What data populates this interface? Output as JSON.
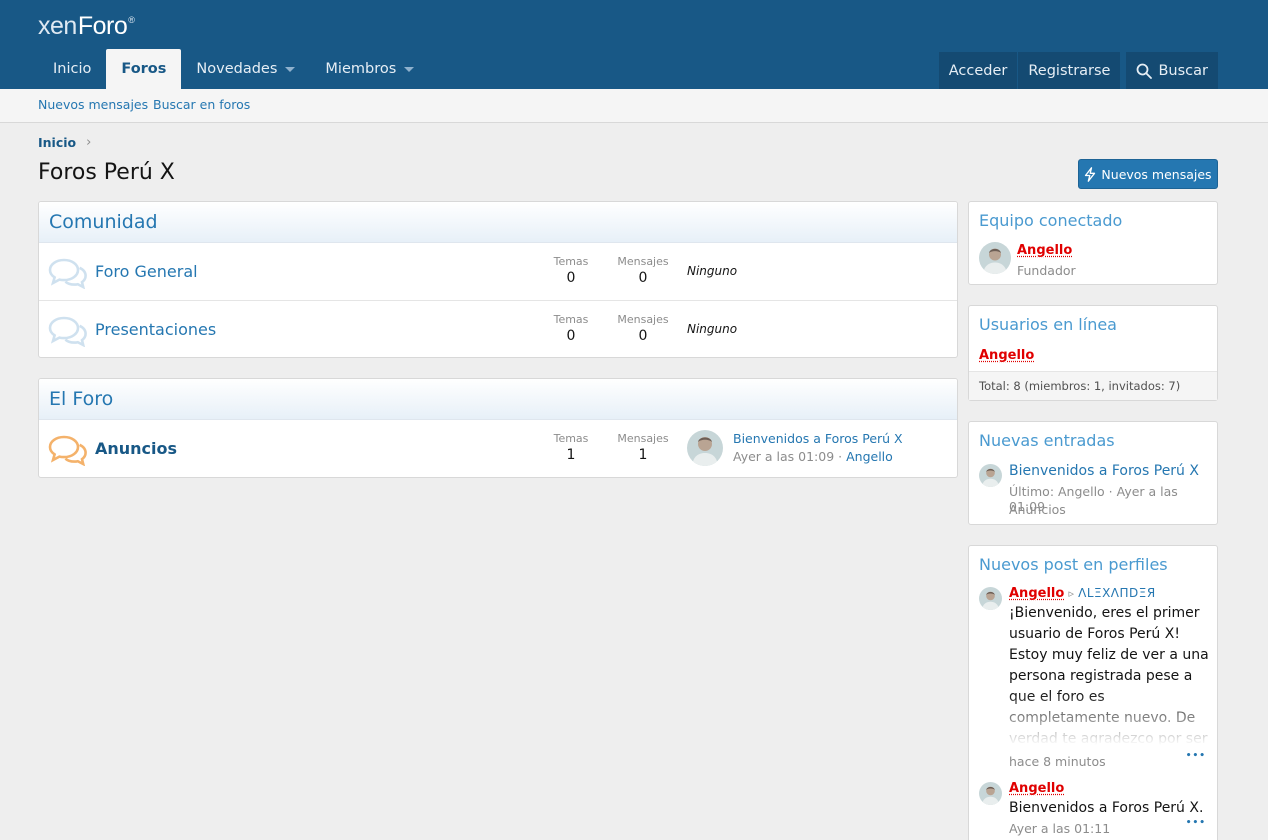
{
  "header": {
    "logo_xen": "xen",
    "logo_foro": "Foro",
    "logo_reg": "®",
    "nav": [
      {
        "label": "Inicio"
      },
      {
        "label": "Foros"
      },
      {
        "label": "Novedades"
      },
      {
        "label": "Miembros"
      }
    ],
    "login": "Acceder",
    "register": "Registrarse",
    "search": "Buscar"
  },
  "subnav": {
    "new_messages": "Nuevos mensajes",
    "search_forums": "Buscar en foros"
  },
  "breadcrumb": {
    "home": "Inicio",
    "chevron": "›"
  },
  "page": {
    "title": "Foros Perú X",
    "new_messages_button": "Nuevos mensajes"
  },
  "categories": [
    {
      "title": "Comunidad",
      "nodes": [
        {
          "title": "Foro General",
          "threads_label": "Temas",
          "threads": "0",
          "messages_label": "Mensajes",
          "messages": "0",
          "last": "Ninguno"
        },
        {
          "title": "Presentaciones",
          "threads_label": "Temas",
          "threads": "0",
          "messages_label": "Mensajes",
          "messages": "0",
          "last": "Ninguno"
        }
      ]
    },
    {
      "title": "El Foro",
      "nodes": [
        {
          "title": "Anuncios",
          "threads_label": "Temas",
          "threads": "1",
          "messages_label": "Mensajes",
          "messages": "1",
          "last_title": "Bienvenidos a Foros Perú X",
          "last_time": "Ayer a las 01:09",
          "last_sep": " · ",
          "last_user": "Angello"
        }
      ]
    }
  ],
  "sidebar": {
    "staff": {
      "title": "Equipo conectado",
      "user": "Angello",
      "role": "Fundador"
    },
    "online": {
      "title": "Usuarios en línea",
      "user": "Angello",
      "total": "Total: 8 (miembros: 1, invitados: 7)"
    },
    "new_posts": {
      "title": "Nuevas entradas",
      "thread": "Bienvenidos a Foros Perú X",
      "meta": "Último: Angello · Ayer a las 01:09",
      "forum": "Anuncios"
    },
    "profile_posts": {
      "title": "Nuevos post en perfiles",
      "items": [
        {
          "user": "Angello",
          "arrow": "▹",
          "target": "ΛLΞXΛПDΞЯ",
          "text": "¡Bienvenido, eres el primer usuario de Foros Perú X! Estoy muy feliz de ver a una persona registrada pese a que el foro es completamente nuevo. De verdad te agradezco por ser",
          "time": "hace 8 minutos",
          "more": "•••"
        },
        {
          "user": "Angello",
          "text": "Bienvenidos a Foros Perú X.",
          "time": "Ayer a las 01:11",
          "more": "•••"
        }
      ]
    }
  },
  "colors": {
    "header_bg": "#185886",
    "link": "#2577b1",
    "username_red": "#e00000",
    "forum_icon_read": "#cfe1ef",
    "forum_icon_unread": "#f4b26b"
  },
  "icons": {
    "forum_read": "chat-bubbles-icon",
    "forum_unread": "chat-bubbles-icon",
    "search": "search-icon",
    "bolt": "bolt-icon"
  }
}
